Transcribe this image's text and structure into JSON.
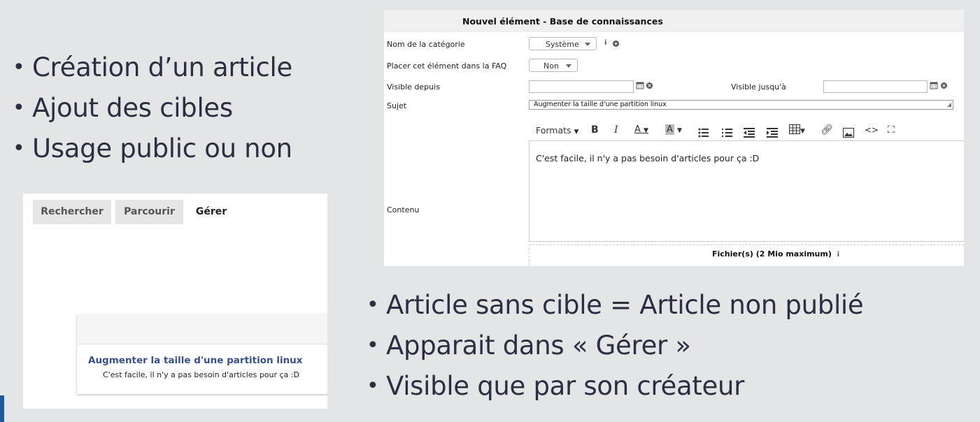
{
  "bullets_top": [
    "Création d’un article",
    "Ajout des cibles",
    "Usage public ou non"
  ],
  "bullets_bottom": [
    "Article sans cible = Article non publié",
    "Apparait dans « Gérer »",
    "Visible que par son créateur"
  ],
  "form": {
    "title": "Nouvel élément - Base de connaissances",
    "category_label": "Nom de la catégorie",
    "category_value": "Système",
    "faq_label": "Placer cet élément dans la FAQ",
    "faq_value": "Non",
    "visible_from_label": "Visible depuis",
    "visible_until_label": "Visible jusqu'à",
    "subject_label": "Sujet",
    "subject_value": "Augmenter la taille d'une partition linux",
    "content_label": "Contenu",
    "formats_label": "Formats",
    "editor_text": "C'est facile, il n'y a pas besoin d'articles pour ça :D",
    "files_label": "Fichier(s) (2 Mio maximum)"
  },
  "tabs": [
    "Rechercher",
    "Parcourir",
    "Gérer"
  ],
  "card": {
    "title": "Augmenter la taille d'une partition linux",
    "text": "C'est facile, il n'y a pas besoin d'articles pour ça :D"
  },
  "colors": {
    "background": "#e4e5e6",
    "link": "#3a4f8e",
    "accent": "#1f5a96"
  },
  "icons": [
    "info-icon",
    "add-icon",
    "calendar-icon",
    "clear-icon",
    "bold-icon",
    "italic-icon",
    "text-color-icon",
    "background-color-icon",
    "bullet-list-icon",
    "numbered-list-icon",
    "outdent-icon",
    "indent-icon",
    "table-icon",
    "link-icon",
    "image-icon",
    "source-code-icon",
    "fullscreen-icon"
  ]
}
